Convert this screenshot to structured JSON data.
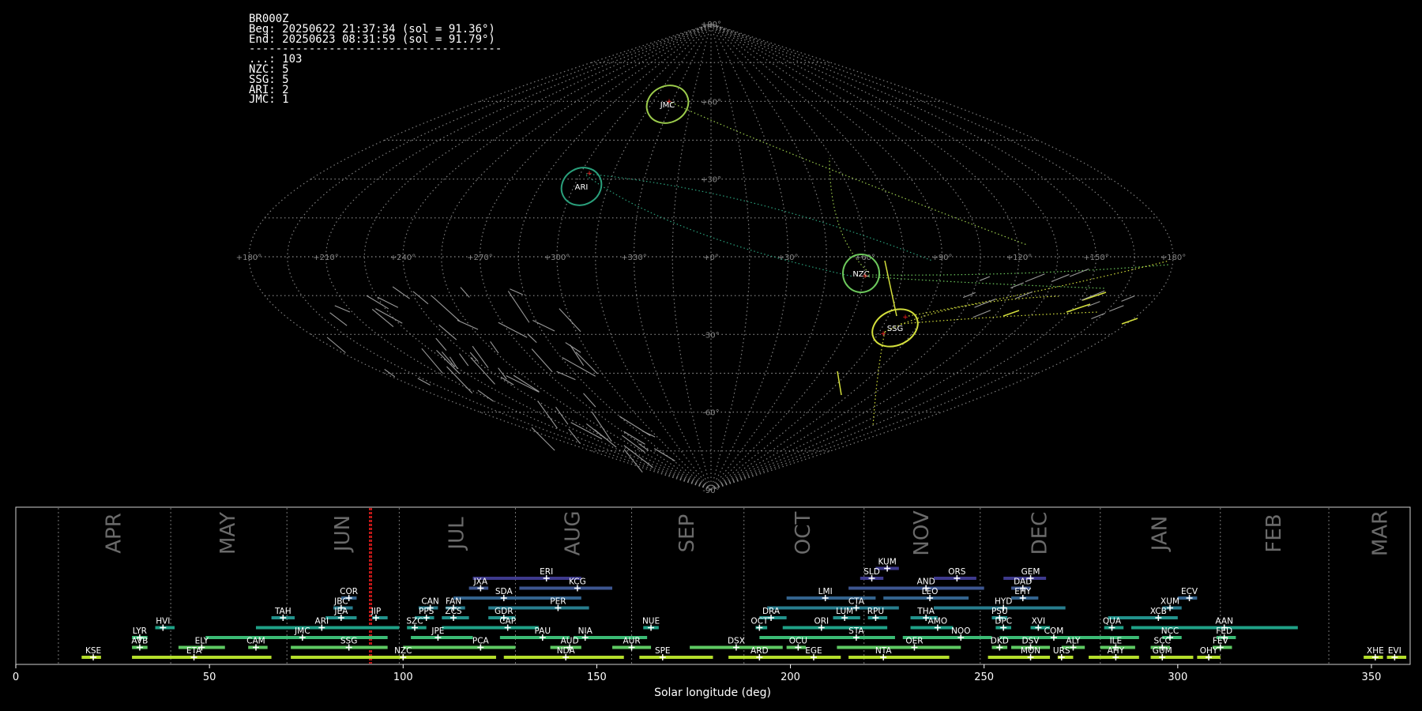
{
  "info": {
    "lines": [
      "BR000Z",
      "Beg: 20250622 21:37:34 (sol = 91.36°)",
      "End: 20250623 08:31:59 (sol = 91.79°)",
      "--------------------------------------",
      "...: 103",
      "NZC: 5",
      "SSG: 5",
      "ARI: 2",
      "JMC: 1"
    ]
  },
  "colors": {
    "grid": "#8c8c8c",
    "red": "#ff2020",
    "label": "#ffffff",
    "month": "#6a6a6a"
  },
  "chart_data": [
    {
      "type": "scatter",
      "projection": "sinusoidal (RA/Dec all-sky)",
      "lon_ticks": [
        "+180°",
        "+150°",
        "+120°",
        "+90°",
        "+60°",
        "+30°",
        "+0°",
        "+330°",
        "+300°",
        "+270°",
        "+240°",
        "+210°",
        "+180°"
      ],
      "lat_ticks": [
        "+90°",
        "+60°",
        "+30°",
        "-30°",
        "-60°",
        "-90°"
      ],
      "showers": [
        {
          "name": "JMC",
          "color": "#9ccc4c"
        },
        {
          "name": "ARI",
          "color": "#2aa07c"
        },
        {
          "name": "NZC",
          "color": "#6cc85c"
        },
        {
          "name": "SSG",
          "color": "#d4e03c"
        }
      ]
    },
    {
      "type": "timeline",
      "xlabel": "Solar longitude (deg)",
      "xlim": [
        0,
        360
      ],
      "x_ticks": [
        0,
        50,
        100,
        150,
        200,
        250,
        300,
        350
      ],
      "current_sol": [
        91.36,
        91.79
      ],
      "months": [
        {
          "name": "APR",
          "start": 11,
          "end": 40
        },
        {
          "name": "MAY",
          "start": 40,
          "end": 70
        },
        {
          "name": "JUN",
          "start": 70,
          "end": 99
        },
        {
          "name": "JUL",
          "start": 99,
          "end": 129
        },
        {
          "name": "AUG",
          "start": 129,
          "end": 159
        },
        {
          "name": "SEP",
          "start": 159,
          "end": 188
        },
        {
          "name": "OCT",
          "start": 188,
          "end": 219
        },
        {
          "name": "NOV",
          "start": 219,
          "end": 249
        },
        {
          "name": "DEC",
          "start": 249,
          "end": 280
        },
        {
          "name": "JAN",
          "start": 280,
          "end": 311
        },
        {
          "name": "FEB",
          "start": 311,
          "end": 339
        },
        {
          "name": "MAR",
          "start": 339,
          "end": 371
        }
      ],
      "showers": [
        {
          "code": "KUM",
          "start": 222,
          "end": 228,
          "peak": 225,
          "row": 11,
          "color": "#3e3a8c"
        },
        {
          "code": "ERI",
          "start": 118,
          "end": 146,
          "peak": 137,
          "row": 10,
          "color": "#3e3a8c"
        },
        {
          "code": "SLD",
          "start": 218,
          "end": 224,
          "peak": 221,
          "row": 10,
          "color": "#3e3a8c"
        },
        {
          "code": "ORS",
          "start": 237,
          "end": 248,
          "peak": 243,
          "row": 10,
          "color": "#3e3a8c"
        },
        {
          "code": "GEM",
          "start": 255,
          "end": 266,
          "peak": 262,
          "row": 10,
          "color": "#3e3a8c"
        },
        {
          "code": "JXA",
          "start": 117,
          "end": 122,
          "peak": 120,
          "row": 9,
          "color": "#3d5690"
        },
        {
          "code": "KCG",
          "start": 130,
          "end": 154,
          "peak": 145,
          "row": 9,
          "color": "#3d5690"
        },
        {
          "code": "AND",
          "start": 215,
          "end": 250,
          "peak": 235,
          "row": 9,
          "color": "#3d5690"
        },
        {
          "code": "DAD",
          "start": 257,
          "end": 262,
          "peak": 260,
          "row": 9,
          "color": "#3d5690"
        },
        {
          "code": "COR",
          "start": 84,
          "end": 88,
          "peak": 86,
          "row": 8,
          "color": "#33638d"
        },
        {
          "code": "SDA",
          "start": 113,
          "end": 146,
          "peak": 126,
          "row": 8,
          "color": "#33638d"
        },
        {
          "code": "LMI",
          "start": 199,
          "end": 222,
          "peak": 209,
          "row": 8,
          "color": "#33638d"
        },
        {
          "code": "LEO",
          "start": 224,
          "end": 246,
          "peak": 236,
          "row": 8,
          "color": "#33638d"
        },
        {
          "code": "EHY",
          "start": 257,
          "end": 264,
          "peak": 260,
          "row": 8,
          "color": "#33638d"
        },
        {
          "code": "ECV",
          "start": 300,
          "end": 305,
          "peak": 303,
          "row": 8,
          "color": "#33638d"
        },
        {
          "code": "JBC",
          "start": 82,
          "end": 87,
          "peak": 84,
          "row": 7,
          "color": "#287d8e"
        },
        {
          "code": "CAN",
          "start": 104,
          "end": 109,
          "peak": 107,
          "row": 7,
          "color": "#287d8e"
        },
        {
          "code": "FAN",
          "start": 111,
          "end": 116,
          "peak": 113,
          "row": 7,
          "color": "#287d8e"
        },
        {
          "code": "PER",
          "start": 122,
          "end": 148,
          "peak": 140,
          "row": 7,
          "color": "#287d8e"
        },
        {
          "code": "CTA",
          "start": 194,
          "end": 228,
          "peak": 217,
          "row": 7,
          "color": "#287d8e"
        },
        {
          "code": "HYD",
          "start": 237,
          "end": 271,
          "peak": 255,
          "row": 7,
          "color": "#287d8e"
        },
        {
          "code": "XUM",
          "start": 296,
          "end": 301,
          "peak": 298,
          "row": 7,
          "color": "#287d8e"
        },
        {
          "code": "TAH",
          "start": 66,
          "end": 72,
          "peak": 69,
          "row": 6,
          "color": "#22928c"
        },
        {
          "code": "JEA",
          "start": 80,
          "end": 88,
          "peak": 84,
          "row": 6,
          "color": "#22928c"
        },
        {
          "code": "JIP",
          "start": 92,
          "end": 96,
          "peak": 93,
          "row": 6,
          "color": "#22928c"
        },
        {
          "code": "PPS",
          "start": 103,
          "end": 108,
          "peak": 106,
          "row": 6,
          "color": "#22928c"
        },
        {
          "code": "ZCS",
          "start": 110,
          "end": 117,
          "peak": 113,
          "row": 6,
          "color": "#22928c"
        },
        {
          "code": "GDR",
          "start": 122,
          "end": 129,
          "peak": 126,
          "row": 6,
          "color": "#22928c"
        },
        {
          "code": "DRA",
          "start": 192,
          "end": 199,
          "peak": 195,
          "row": 6,
          "color": "#22928c"
        },
        {
          "code": "LUM",
          "start": 211,
          "end": 218,
          "peak": 214,
          "row": 6,
          "color": "#22928c"
        },
        {
          "code": "RPU",
          "start": 220,
          "end": 225,
          "peak": 222,
          "row": 6,
          "color": "#22928c"
        },
        {
          "code": "THA",
          "start": 231,
          "end": 238,
          "peak": 235,
          "row": 6,
          "color": "#22928c"
        },
        {
          "code": "PSU",
          "start": 252,
          "end": 256,
          "peak": 254,
          "row": 6,
          "color": "#22928c"
        },
        {
          "code": "XCB",
          "start": 282,
          "end": 300,
          "peak": 295,
          "row": 6,
          "color": "#22928c"
        },
        {
          "code": "HVI",
          "start": 36,
          "end": 41,
          "peak": 38,
          "row": 5,
          "color": "#1fa187"
        },
        {
          "code": "ARI",
          "start": 62,
          "end": 99,
          "peak": 79,
          "row": 5,
          "color": "#1fa187"
        },
        {
          "code": "SZC",
          "start": 101,
          "end": 106,
          "peak": 103,
          "row": 5,
          "color": "#1fa187"
        },
        {
          "code": "CAP",
          "start": 110,
          "end": 135,
          "peak": 127,
          "row": 5,
          "color": "#1fa187"
        },
        {
          "code": "NUE",
          "start": 162,
          "end": 166,
          "peak": 164,
          "row": 5,
          "color": "#1fa187"
        },
        {
          "code": "OCT",
          "start": 191,
          "end": 194,
          "peak": 192,
          "row": 5,
          "color": "#1fa187"
        },
        {
          "code": "ORI",
          "start": 198,
          "end": 225,
          "peak": 208,
          "row": 5,
          "color": "#1fa187"
        },
        {
          "code": "AMO",
          "start": 231,
          "end": 242,
          "peak": 238,
          "row": 5,
          "color": "#1fa187"
        },
        {
          "code": "DPC",
          "start": 253,
          "end": 257,
          "peak": 255,
          "row": 5,
          "color": "#1fa187"
        },
        {
          "code": "XVI",
          "start": 262,
          "end": 267,
          "peak": 264,
          "row": 5,
          "color": "#1fa187"
        },
        {
          "code": "QUA",
          "start": 281,
          "end": 286,
          "peak": 283,
          "row": 5,
          "color": "#1fa187"
        },
        {
          "code": "AAN",
          "start": 288,
          "end": 331,
          "peak": 312,
          "row": 5,
          "color": "#1fa187"
        },
        {
          "code": "LYR",
          "start": 30,
          "end": 34,
          "peak": 32,
          "row": 4,
          "color": "#3bbb75"
        },
        {
          "code": "JMC",
          "start": 49,
          "end": 96,
          "peak": 74,
          "row": 4,
          "color": "#3bbb75"
        },
        {
          "code": "JPE",
          "start": 102,
          "end": 118,
          "peak": 109,
          "row": 4,
          "color": "#3bbb75"
        },
        {
          "code": "PAU",
          "start": 125,
          "end": 143,
          "peak": 136,
          "row": 4,
          "color": "#3bbb75"
        },
        {
          "code": "NIA",
          "start": 144,
          "end": 163,
          "peak": 147,
          "row": 4,
          "color": "#3bbb75"
        },
        {
          "code": "STA",
          "start": 192,
          "end": 227,
          "peak": 217,
          "row": 4,
          "color": "#3bbb75"
        },
        {
          "code": "NOO",
          "start": 229,
          "end": 252,
          "peak": 244,
          "row": 4,
          "color": "#3bbb75"
        },
        {
          "code": "COM",
          "start": 254,
          "end": 290,
          "peak": 268,
          "row": 4,
          "color": "#3bbb75"
        },
        {
          "code": "NCC",
          "start": 296,
          "end": 301,
          "peak": 298,
          "row": 4,
          "color": "#3bbb75"
        },
        {
          "code": "FED",
          "start": 310,
          "end": 315,
          "peak": 312,
          "row": 4,
          "color": "#3bbb75"
        },
        {
          "code": "AVB",
          "start": 30,
          "end": 34,
          "peak": 32,
          "row": 3,
          "color": "#5ec962"
        },
        {
          "code": "ELY",
          "start": 42,
          "end": 54,
          "peak": 48,
          "row": 3,
          "color": "#5ec962"
        },
        {
          "code": "CAM",
          "start": 60,
          "end": 65,
          "peak": 62,
          "row": 3,
          "color": "#5ec962"
        },
        {
          "code": "SSG",
          "start": 71,
          "end": 96,
          "peak": 86,
          "row": 3,
          "color": "#5ec962"
        },
        {
          "code": "PCA",
          "start": 100,
          "end": 129,
          "peak": 120,
          "row": 3,
          "color": "#5ec962"
        },
        {
          "code": "AUD",
          "start": 138,
          "end": 146,
          "peak": 143,
          "row": 3,
          "color": "#5ec962"
        },
        {
          "code": "AUR",
          "start": 154,
          "end": 164,
          "peak": 159,
          "row": 3,
          "color": "#5ec962"
        },
        {
          "code": "DSX",
          "start": 174,
          "end": 198,
          "peak": 186,
          "row": 3,
          "color": "#5ec962"
        },
        {
          "code": "OCU",
          "start": 199,
          "end": 204,
          "peak": 202,
          "row": 3,
          "color": "#5ec962"
        },
        {
          "code": "OER",
          "start": 212,
          "end": 244,
          "peak": 232,
          "row": 3,
          "color": "#5ec962"
        },
        {
          "code": "DKD",
          "start": 252,
          "end": 256,
          "peak": 254,
          "row": 3,
          "color": "#5ec962"
        },
        {
          "code": "DSV",
          "start": 257,
          "end": 267,
          "peak": 262,
          "row": 3,
          "color": "#5ec962"
        },
        {
          "code": "ALY",
          "start": 270,
          "end": 276,
          "peak": 273,
          "row": 3,
          "color": "#5ec962"
        },
        {
          "code": "ILE",
          "start": 280,
          "end": 289,
          "peak": 284,
          "row": 3,
          "color": "#5ec962"
        },
        {
          "code": "SCC",
          "start": 293,
          "end": 298,
          "peak": 296,
          "row": 3,
          "color": "#5ec962"
        },
        {
          "code": "FEV",
          "start": 309,
          "end": 314,
          "peak": 311,
          "row": 3,
          "color": "#5ec962"
        },
        {
          "code": "KSE",
          "start": 17,
          "end": 22,
          "peak": 20,
          "row": 2,
          "color": "#b5de2b"
        },
        {
          "code": "ETA",
          "start": 30,
          "end": 66,
          "peak": 46,
          "row": 2,
          "color": "#b5de2b"
        },
        {
          "code": "NZC",
          "start": 71,
          "end": 124,
          "peak": 100,
          "row": 2,
          "color": "#b5de2b"
        },
        {
          "code": "NDA",
          "start": 126,
          "end": 157,
          "peak": 142,
          "row": 2,
          "color": "#b5de2b"
        },
        {
          "code": "SPE",
          "start": 161,
          "end": 180,
          "peak": 167,
          "row": 2,
          "color": "#b5de2b"
        },
        {
          "code": "ARD",
          "start": 184,
          "end": 201,
          "peak": 192,
          "row": 2,
          "color": "#b5de2b"
        },
        {
          "code": "EGE",
          "start": 196,
          "end": 213,
          "peak": 206,
          "row": 2,
          "color": "#b5de2b"
        },
        {
          "code": "NTA",
          "start": 215,
          "end": 241,
          "peak": 224,
          "row": 2,
          "color": "#b5de2b"
        },
        {
          "code": "MON",
          "start": 251,
          "end": 267,
          "peak": 262,
          "row": 2,
          "color": "#b5de2b"
        },
        {
          "code": "URS",
          "start": 269,
          "end": 273,
          "peak": 270,
          "row": 2,
          "color": "#b5de2b"
        },
        {
          "code": "AHY",
          "start": 277,
          "end": 290,
          "peak": 284,
          "row": 2,
          "color": "#b5de2b"
        },
        {
          "code": "GUM",
          "start": 293,
          "end": 304,
          "peak": 296,
          "row": 2,
          "color": "#b5de2b"
        },
        {
          "code": "OHY",
          "start": 305,
          "end": 311,
          "peak": 308,
          "row": 2,
          "color": "#b5de2b"
        },
        {
          "code": "XHE",
          "start": 348,
          "end": 353,
          "peak": 351,
          "row": 2,
          "color": "#b5de2b"
        },
        {
          "code": "EVI",
          "start": 354,
          "end": 359,
          "peak": 356,
          "row": 2,
          "color": "#b5de2b"
        }
      ]
    }
  ]
}
